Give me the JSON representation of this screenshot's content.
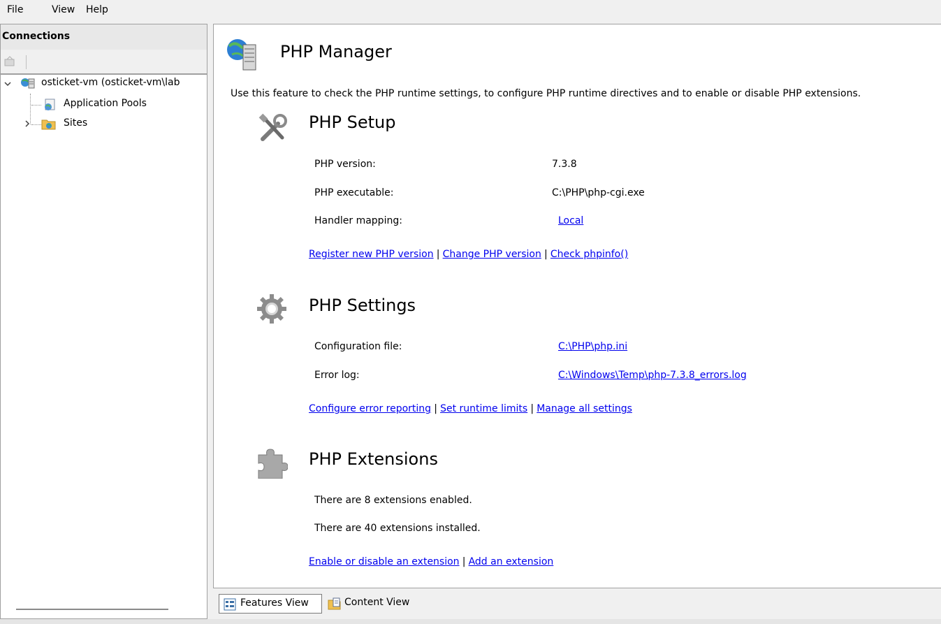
{
  "menu": {
    "file": "File",
    "view": "View",
    "help": "Help"
  },
  "connections": {
    "title": "Connections",
    "tree": [
      {
        "label": "osticket-vm (osticket-vm\\lab"
      },
      {
        "label": "Application Pools"
      },
      {
        "label": "Sites"
      }
    ]
  },
  "page": {
    "title": "PHP Manager",
    "description": "Use this feature to check the PHP runtime settings, to configure PHP runtime directives and to enable or disable PHP extensions."
  },
  "setup": {
    "title": "PHP Setup",
    "rows": [
      {
        "label": "PHP version:",
        "value": "7.3.8"
      },
      {
        "label": "PHP executable:",
        "value": "C:\\PHP\\php-cgi.exe"
      },
      {
        "label": "Handler mapping:",
        "value": "Local"
      }
    ],
    "links": [
      "Register new PHP version",
      "Change PHP version",
      "Check phpinfo()"
    ],
    "separator": "|"
  },
  "settings": {
    "title": "PHP Settings",
    "rows": [
      {
        "label": "Configuration file:",
        "value": "C:\\PHP\\php.ini"
      },
      {
        "label": "Error log:",
        "value": "C:\\Windows\\Temp\\php-7.3.8_errors.log"
      }
    ],
    "links": [
      "Configure error reporting",
      "Set runtime limits",
      "Manage all settings"
    ],
    "separator": "|"
  },
  "extensions": {
    "title": "PHP Extensions",
    "lines": [
      "There are 8 extensions enabled.",
      "There are 40 extensions installed."
    ],
    "links": [
      "Enable or disable an extension",
      "Add an extension"
    ],
    "separator": "|"
  },
  "views": {
    "features": "Features View",
    "content": "Content View"
  },
  "colors": {
    "link": "#0000ee",
    "panel_bg": "#ffffff",
    "chrome_bg": "#f0f0f0"
  }
}
